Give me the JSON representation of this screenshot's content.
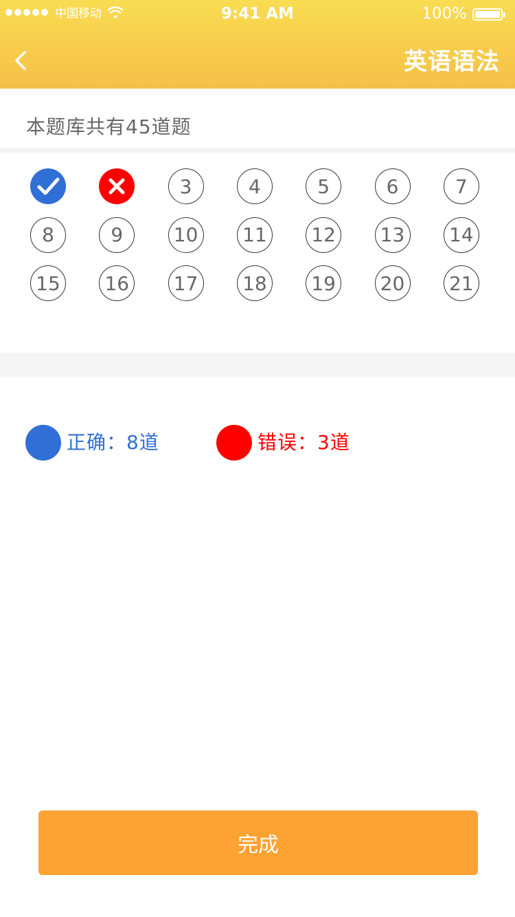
{
  "status_bar": {
    "carrier": "中国移动",
    "time": "9:41 AM",
    "battery": "100%"
  },
  "nav": {
    "title": "英语语法",
    "back_icon": "chevron-left-icon"
  },
  "summary": {
    "text": "本题库共有45道题"
  },
  "questions": [
    {
      "number": "1",
      "state": "correct",
      "icon": "check-icon"
    },
    {
      "number": "2",
      "state": "wrong",
      "icon": "close-icon"
    },
    {
      "number": "3",
      "state": "unanswered"
    },
    {
      "number": "4",
      "state": "unanswered"
    },
    {
      "number": "5",
      "state": "unanswered"
    },
    {
      "number": "6",
      "state": "unanswered"
    },
    {
      "number": "7",
      "state": "unanswered"
    },
    {
      "number": "8",
      "state": "unanswered"
    },
    {
      "number": "9",
      "state": "unanswered"
    },
    {
      "number": "10",
      "state": "unanswered"
    },
    {
      "number": "11",
      "state": "unanswered"
    },
    {
      "number": "12",
      "state": "unanswered"
    },
    {
      "number": "13",
      "state": "unanswered"
    },
    {
      "number": "14",
      "state": "unanswered"
    },
    {
      "number": "15",
      "state": "unanswered"
    },
    {
      "number": "16",
      "state": "unanswered"
    },
    {
      "number": "17",
      "state": "unanswered"
    },
    {
      "number": "18",
      "state": "unanswered"
    },
    {
      "number": "19",
      "state": "unanswered"
    },
    {
      "number": "20",
      "state": "unanswered"
    },
    {
      "number": "21",
      "state": "unanswered"
    }
  ],
  "legend": {
    "correct": {
      "label": "正确：8道",
      "color": "#2f6fd6"
    },
    "wrong": {
      "label": "错误：3道",
      "color": "#ff0000"
    }
  },
  "actions": {
    "done_label": "完成"
  },
  "colors": {
    "header": "#f7cb4b",
    "button": "#fda233"
  }
}
